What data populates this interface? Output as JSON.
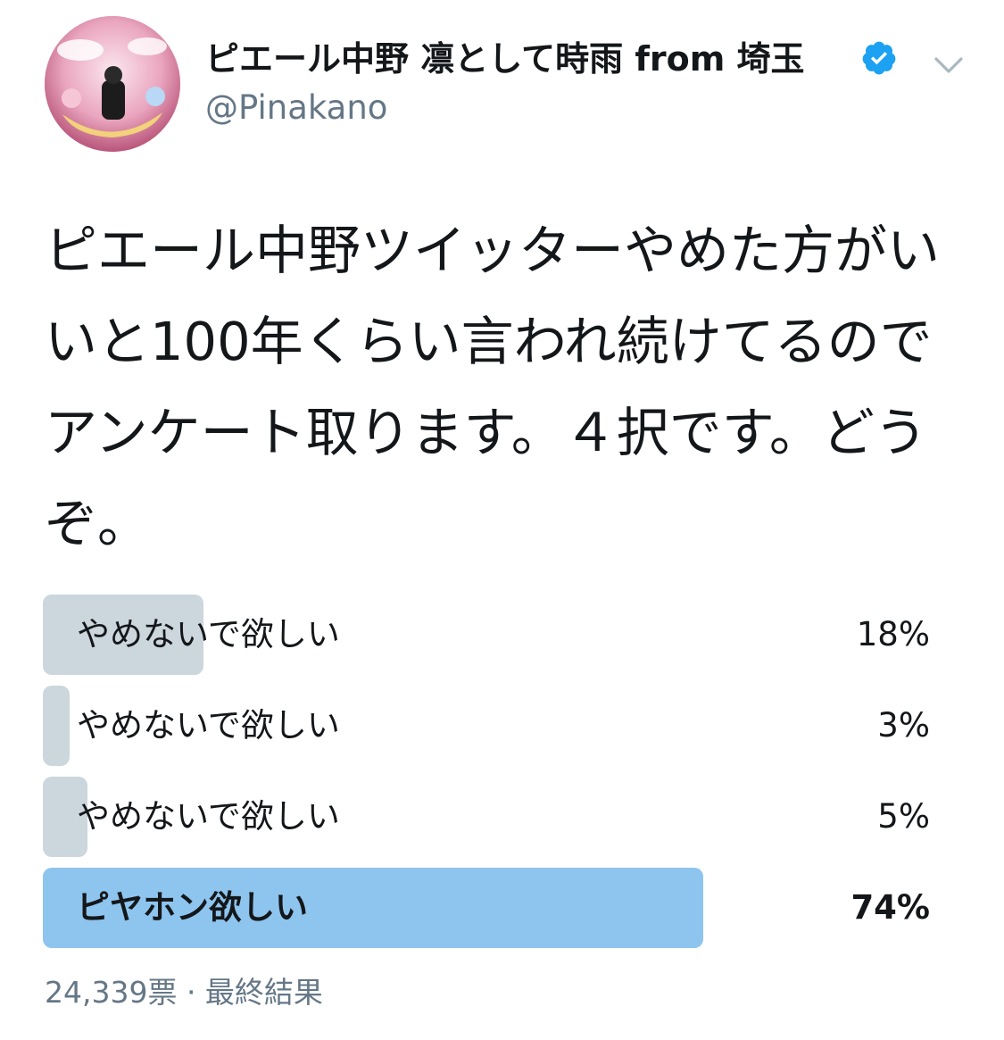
{
  "header": {
    "display_name": "ピエール中野 凛として時雨 from 埼玉",
    "handle": "@Pinakano",
    "verified": true,
    "avatar_icon": "profile-avatar",
    "more_icon": "chevron-down-icon"
  },
  "tweet": {
    "text": "ピエール中野ツイッターやめた方がいいと100年くらい言われ続けてるのでアンケート取ります。４択です。どうぞ。"
  },
  "poll": {
    "options": [
      {
        "label": "やめないで欲しい",
        "percent_text": "18%",
        "percent": 18,
        "winner": false
      },
      {
        "label": "やめないで欲しい",
        "percent_text": "3%",
        "percent": 3,
        "winner": false
      },
      {
        "label": "やめないで欲しい",
        "percent_text": "5%",
        "percent": 5,
        "winner": false
      },
      {
        "label": "ピヤホン欲しい",
        "percent_text": "74%",
        "percent": 74,
        "winner": true
      }
    ],
    "footer": "24,339票 · 最終結果"
  },
  "colors": {
    "bar_default": "#ccd6dd",
    "bar_winner": "#8ec5ef",
    "verified_blue": "#1da1f2",
    "secondary_text": "#657786"
  }
}
